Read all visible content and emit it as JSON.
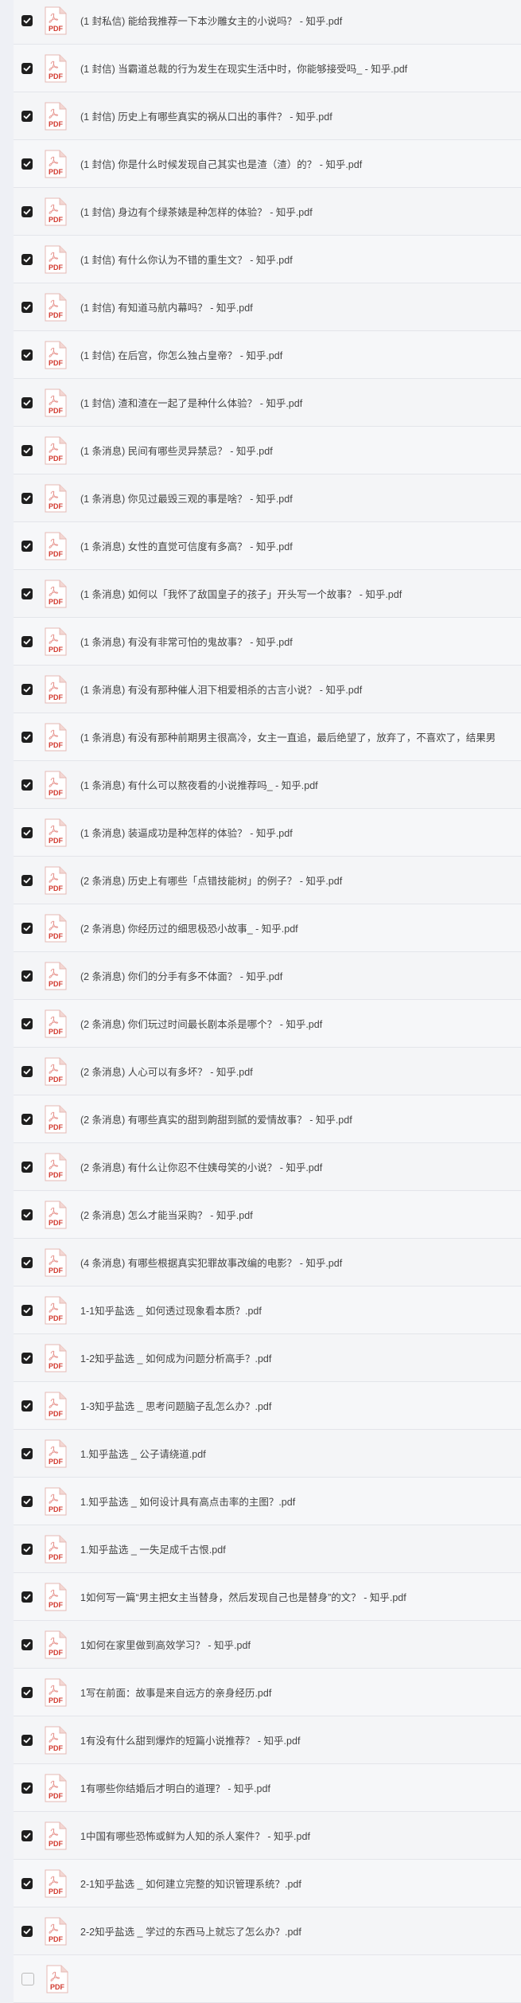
{
  "icons": {
    "checkbox": "checkmark-icon",
    "file": "pdf-file-icon",
    "pdf_label": "PDF",
    "pdf_color": "#d23a2f"
  },
  "files": [
    {
      "name": "(1 封私信) 能给我推荐一下本沙雕女主的小说吗？ - 知乎.pdf",
      "checked": true
    },
    {
      "name": "(1 封信) 当霸道总裁的行为发生在现实生活中时，你能够接受吗_ - 知乎.pdf",
      "checked": true
    },
    {
      "name": "(1 封信) 历史上有哪些真实的祸从口出的事件？ - 知乎.pdf",
      "checked": true
    },
    {
      "name": "(1 封信) 你是什么时候发现自己其实也是渣（渣）的？ - 知乎.pdf",
      "checked": true
    },
    {
      "name": "(1 封信) 身边有个绿茶婊是种怎样的体验？ - 知乎.pdf",
      "checked": true
    },
    {
      "name": "(1 封信) 有什么你认为不错的重生文？ - 知乎.pdf",
      "checked": true
    },
    {
      "name": "(1 封信) 有知道马航内幕吗？ - 知乎.pdf",
      "checked": true
    },
    {
      "name": "(1 封信) 在后宫，你怎么独占皇帝？ - 知乎.pdf",
      "checked": true
    },
    {
      "name": "(1 封信) 渣和渣在一起了是种什么体验？ - 知乎.pdf",
      "checked": true
    },
    {
      "name": "(1 条消息) 民间有哪些灵异禁忌？ - 知乎.pdf",
      "checked": true
    },
    {
      "name": "(1 条消息) 你见过最毁三观的事是啥？ - 知乎.pdf",
      "checked": true
    },
    {
      "name": "(1 条消息) 女性的直觉可信度有多高？ - 知乎.pdf",
      "checked": true
    },
    {
      "name": "(1 条消息) 如何以「我怀了敌国皇子的孩子」开头写一个故事？ - 知乎.pdf",
      "checked": true
    },
    {
      "name": "(1 条消息) 有没有非常可怕的鬼故事？ - 知乎.pdf",
      "checked": true
    },
    {
      "name": "(1 条消息) 有没有那种催人泪下相爱相杀的古言小说？ - 知乎.pdf",
      "checked": true
    },
    {
      "name": "(1 条消息) 有没有那种前期男主很高冷，女主一直追，最后绝望了，放弃了，不喜欢了，结果男",
      "checked": true
    },
    {
      "name": "(1 条消息) 有什么可以熬夜看的小说推荐吗_ - 知乎.pdf",
      "checked": true
    },
    {
      "name": "(1 条消息) 装逼成功是种怎样的体验？ - 知乎.pdf",
      "checked": true
    },
    {
      "name": "(2 条消息) 历史上有哪些「点错技能树」的例子？ - 知乎.pdf",
      "checked": true
    },
    {
      "name": "(2 条消息) 你经历过的细思极恐小故事_ - 知乎.pdf",
      "checked": true
    },
    {
      "name": "(2 条消息) 你们的分手有多不体面？ - 知乎.pdf",
      "checked": true
    },
    {
      "name": "(2 条消息) 你们玩过时间最长剧本杀是哪个？ - 知乎.pdf",
      "checked": true
    },
    {
      "name": "(2 条消息) 人心可以有多坏？ - 知乎.pdf",
      "checked": true
    },
    {
      "name": "(2 条消息) 有哪些真实的甜到齁甜到腻的爱情故事？ - 知乎.pdf",
      "checked": true
    },
    {
      "name": "(2 条消息) 有什么让你忍不住姨母笑的小说？ - 知乎.pdf",
      "checked": true
    },
    {
      "name": "(2 条消息) 怎么才能当采购？ - 知乎.pdf",
      "checked": true
    },
    {
      "name": "(4 条消息) 有哪些根据真实犯罪故事改编的电影？ - 知乎.pdf",
      "checked": true
    },
    {
      "name": "1-1知乎盐选 _ 如何透过现象看本质？.pdf",
      "checked": true
    },
    {
      "name": "1-2知乎盐选 _ 如何成为问题分析高手？.pdf",
      "checked": true
    },
    {
      "name": "1-3知乎盐选 _ 思考问题脑子乱怎么办？.pdf",
      "checked": true
    },
    {
      "name": "1.知乎盐选 _ 公子请绕道.pdf",
      "checked": true
    },
    {
      "name": "1.知乎盐选 _ 如何设计具有高点击率的主图？.pdf",
      "checked": true
    },
    {
      "name": "1.知乎盐选 _ 一失足成千古恨.pdf",
      "checked": true
    },
    {
      "name": "1如何写一篇“男主把女主当替身，然后发现自己也是替身”的文？ - 知乎.pdf",
      "checked": true
    },
    {
      "name": "1如何在家里做到高效学习？ - 知乎.pdf",
      "checked": true
    },
    {
      "name": "1写在前面：故事是来自远方的亲身经历.pdf",
      "checked": true
    },
    {
      "name": "1有没有什么甜到爆炸的短篇小说推荐？ - 知乎.pdf",
      "checked": true
    },
    {
      "name": "1有哪些你结婚后才明白的道理？ - 知乎.pdf",
      "checked": true
    },
    {
      "name": "1中国有哪些恐怖或鲜为人知的杀人案件？ - 知乎.pdf",
      "checked": true
    },
    {
      "name": "2-1知乎盐选 _ 如何建立完整的知识管理系统？.pdf",
      "checked": true
    },
    {
      "name": "2-2知乎盐选 _ 学过的东西马上就忘了怎么办？.pdf",
      "checked": true
    },
    {
      "name": "",
      "checked": false
    }
  ]
}
